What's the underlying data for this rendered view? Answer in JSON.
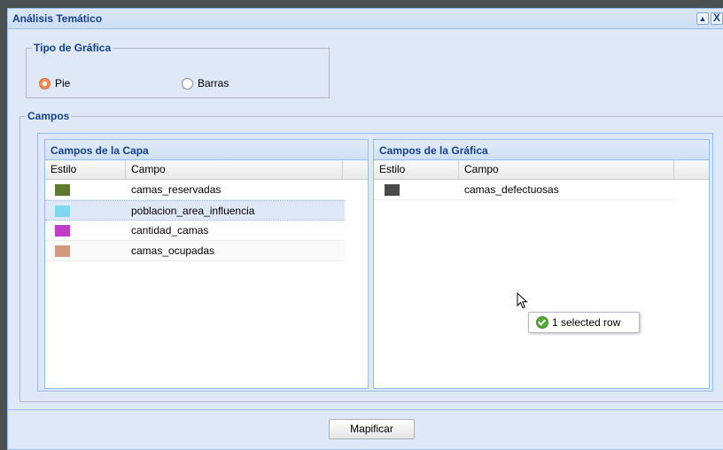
{
  "window": {
    "title": "Análisis Temático",
    "collapse_glyph": "▲",
    "close_glyph": "X"
  },
  "tipo_grafica": {
    "legend": "Tipo de Gráfica",
    "options": [
      {
        "label": "Pie",
        "checked": true
      },
      {
        "label": "Barras",
        "checked": false
      }
    ]
  },
  "campos": {
    "legend": "Campos",
    "capa": {
      "title": "Campos de la Capa",
      "columns": [
        "Estilo",
        "Campo"
      ],
      "rows": [
        {
          "color": "#5e7a2e",
          "campo": "camas_reservadas"
        },
        {
          "color": "#7fd8f2",
          "campo": "poblacion_area_influencia"
        },
        {
          "color": "#c23cc8",
          "campo": "cantidad_camas"
        },
        {
          "color": "#d39a80",
          "campo": "camas_ocupadas"
        }
      ]
    },
    "grafica": {
      "title": "Campos de la Gráfica",
      "columns": [
        "Estilo",
        "Campo"
      ],
      "rows": [
        {
          "color": "#4a4a4a",
          "campo": "camas_defectuosas"
        }
      ]
    }
  },
  "tooltip": {
    "text": "1 selected row",
    "icon": "check-circle-icon"
  },
  "buttons": {
    "mapificar": "Mapificar"
  }
}
